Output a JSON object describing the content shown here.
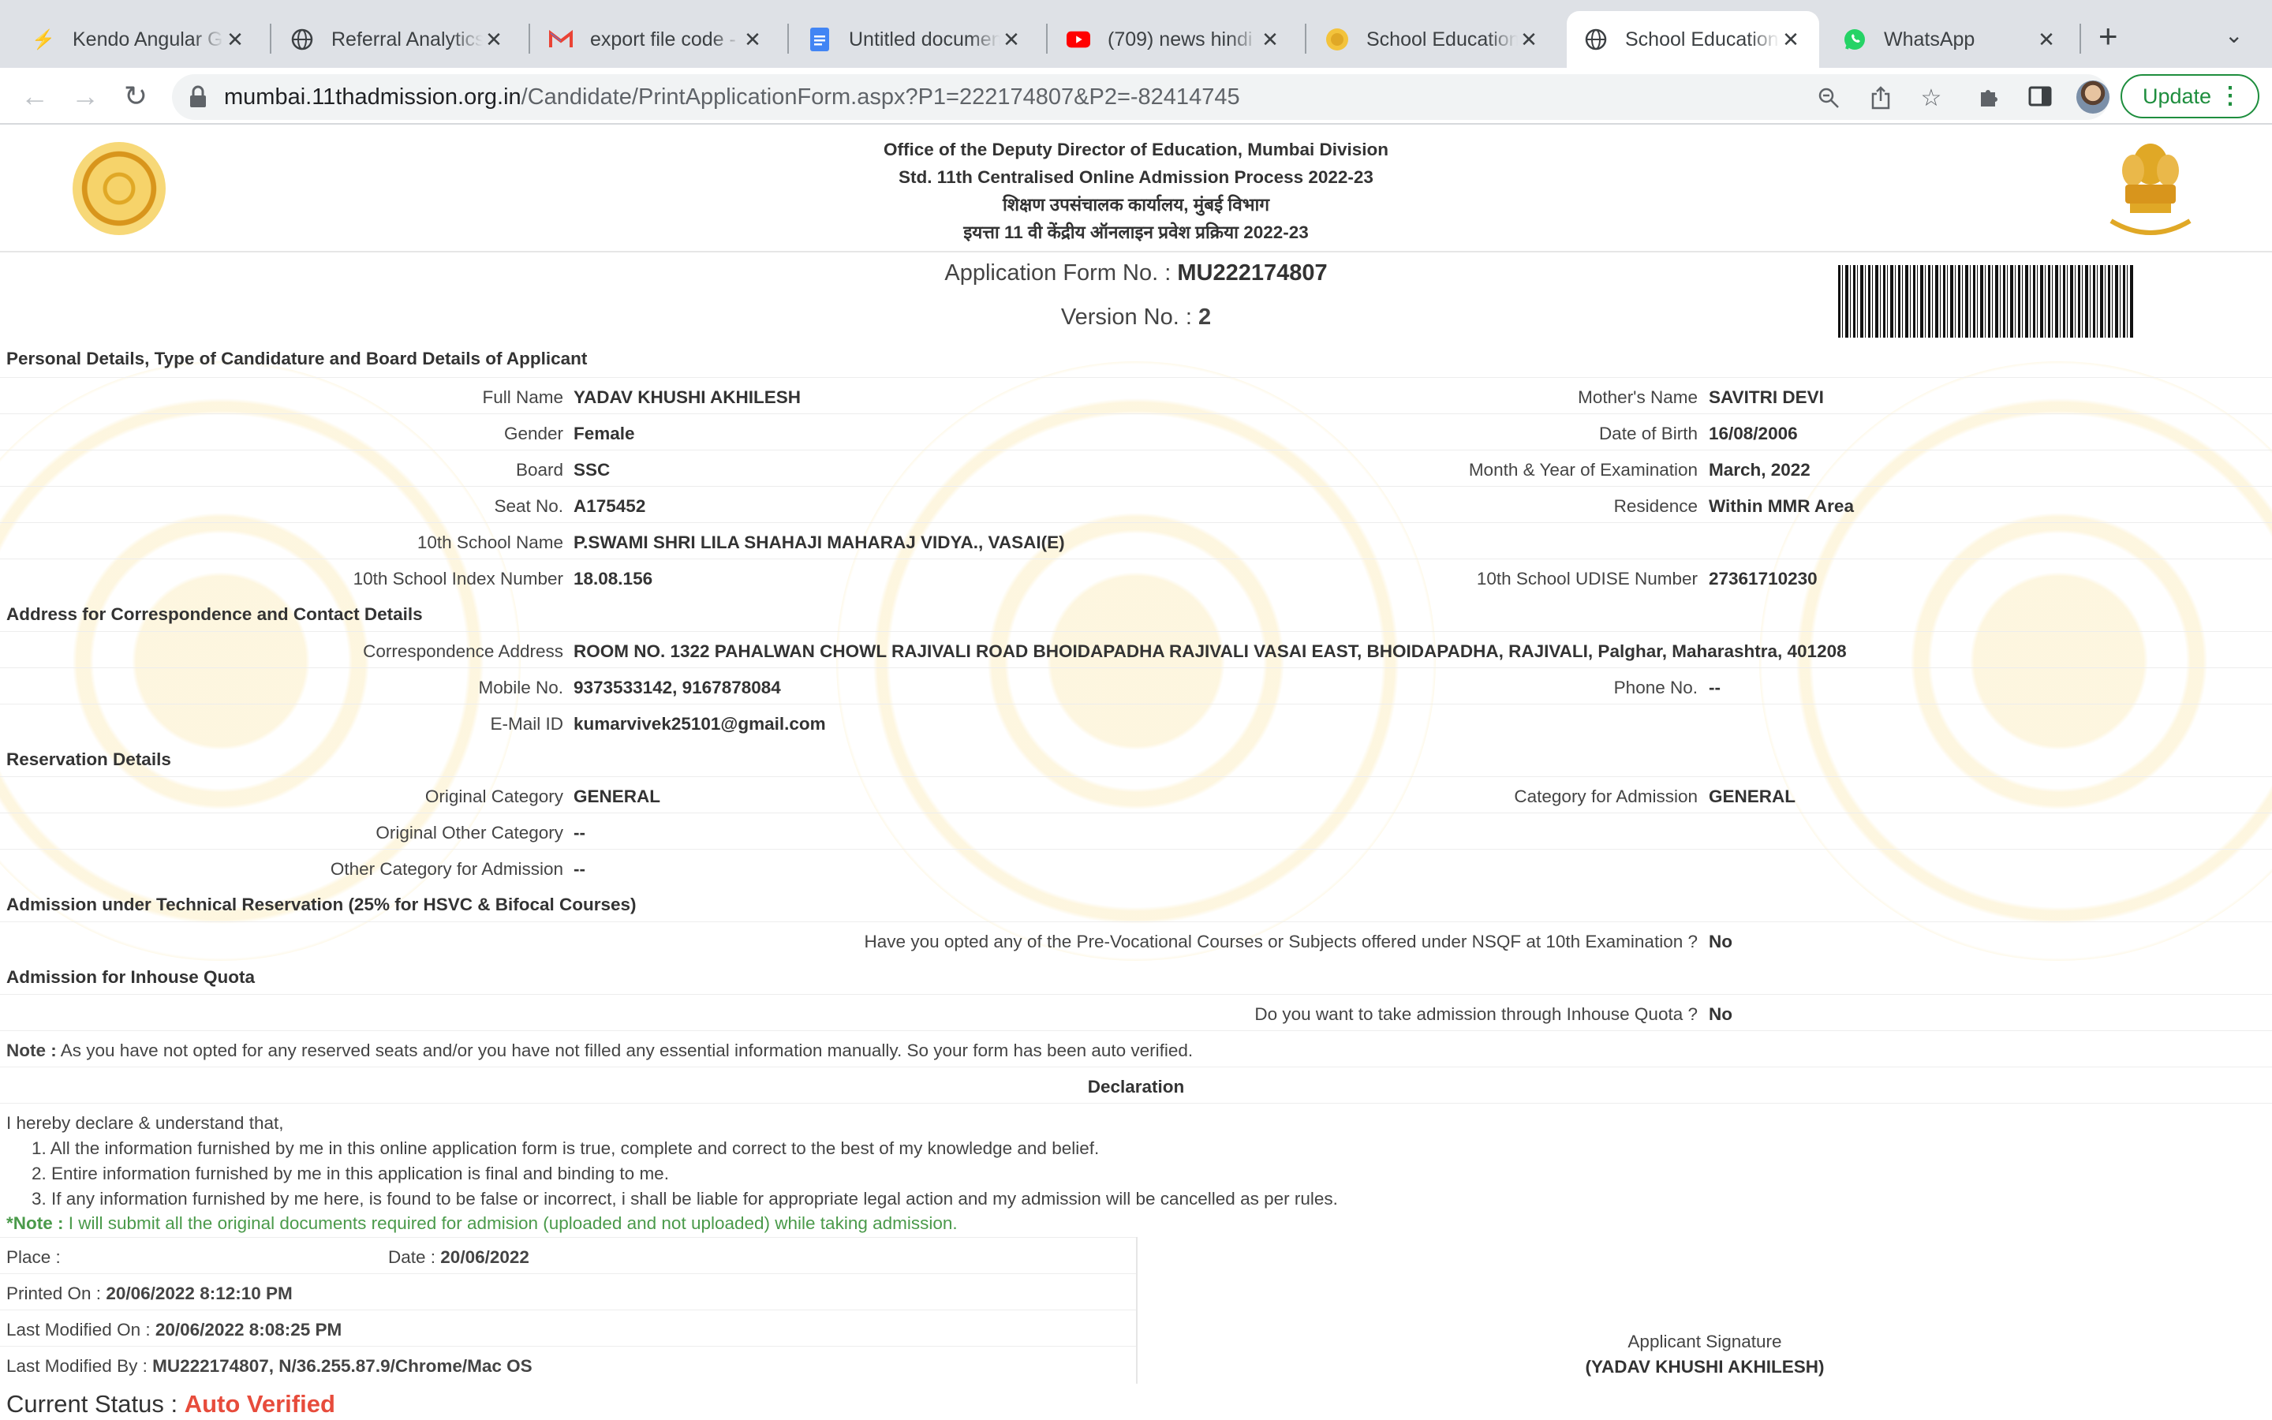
{
  "browser": {
    "tabs": [
      {
        "title": "Kendo Angular Gr",
        "favicon": "bolt-icon",
        "color": "#4b6bfb"
      },
      {
        "title": "Referral Analytics",
        "favicon": "globe-icon",
        "color": "#5f6368"
      },
      {
        "title": "export file code -",
        "favicon": "gmail-icon",
        "color": "#ea4335"
      },
      {
        "title": "Untitled documen",
        "favicon": "docs-icon",
        "color": "#4285f4"
      },
      {
        "title": "(709) news hindi",
        "favicon": "youtube-icon",
        "color": "#ff0000"
      },
      {
        "title": "School Education",
        "favicon": "seal-icon",
        "color": "#e0a826"
      },
      {
        "title": "School Education",
        "favicon": "globe-icon",
        "color": "#5f6368"
      },
      {
        "title": "WhatsApp",
        "favicon": "whatsapp-icon",
        "color": "#25d366"
      }
    ],
    "new_tab": "+",
    "url_host": "mumbai.11thadmission.org.in",
    "url_path": "/Candidate/PrintApplicationForm.aspx?P1=222174807&P2=-82414745",
    "update_label": "Update"
  },
  "header": {
    "line1": "Office of the Deputy Director of Education, Mumbai Division",
    "line2": "Std. 11th Centralised Online Admission Process 2022-23",
    "line3": "शिक्षण उपसंचालक कार्यालय, मुंबई विभाग",
    "line4": "इयत्ता 11 वी केंद्रीय ऑनलाइन प्रवेश प्रक्रिया 2022-23"
  },
  "form": {
    "form_no_label": "Application Form No. :",
    "form_no": "MU222174807",
    "version_label": "Version No. :",
    "version": "2"
  },
  "sections": {
    "personal": "Personal Details, Type of Candidature and Board Details of Applicant",
    "address": "Address for Correspondence and Contact Details",
    "reservation": "Reservation Details",
    "technical": "Admission under Technical Reservation (25% for HSVC & Bifocal Courses)",
    "inhouse": "Admission for Inhouse Quota",
    "declaration": "Declaration"
  },
  "personal": {
    "full_name_label": "Full Name",
    "full_name": "YADAV KHUSHI AKHILESH",
    "mother_label": "Mother's Name",
    "mother": "SAVITRI DEVI",
    "gender_label": "Gender",
    "gender": "Female",
    "dob_label": "Date of Birth",
    "dob": "16/08/2006",
    "board_label": "Board",
    "board": "SSC",
    "exam_label": "Month & Year of Examination",
    "exam": "March, 2022",
    "seat_label": "Seat No.",
    "seat": "A175452",
    "residence_label": "Residence",
    "residence": "Within MMR Area",
    "school_label": "10th School Name",
    "school": "P.SWAMI SHRI LILA SHAHAJI MAHARAJ VIDYA., VASAI(E)",
    "index_label": "10th School Index Number",
    "index": "18.08.156",
    "udise_label": "10th School UDISE Number",
    "udise": "27361710230"
  },
  "address": {
    "corr_label": "Correspondence Address",
    "corr": "ROOM NO. 1322 PAHALWAN CHOWL RAJIVALI ROAD BHOIDAPADHA RAJIVALI VASAI EAST, BHOIDAPADHA, RAJIVALI, Palghar, Maharashtra, 401208",
    "mobile_label": "Mobile No.",
    "mobile": "9373533142, 9167878084",
    "phone_label": "Phone No.",
    "phone": "--",
    "email_label": "E-Mail ID",
    "email": "kumarvivek25101@gmail.com"
  },
  "reservation": {
    "orig_cat_label": "Original Category",
    "orig_cat": "GENERAL",
    "adm_cat_label": "Category for Admission",
    "adm_cat": "GENERAL",
    "orig_other_label": "Original Other Category",
    "orig_other": "--",
    "other_adm_label": "Other Category for Admission",
    "other_adm": "--"
  },
  "technical": {
    "question": "Have you opted any of the Pre-Vocational Courses or Subjects offered under NSQF at 10th Examination ?",
    "answer": "No"
  },
  "inhouse": {
    "question": "Do you want to take admission through Inhouse Quota ?",
    "answer": "No"
  },
  "note": {
    "label": "Note :",
    "text": "As you have not opted for any reserved seats and/or you have not filled any essential information manually. So your form has been auto verified."
  },
  "declaration": {
    "intro": "I hereby declare & understand that,",
    "items": [
      "1. All the information furnished by me in this online application form is true, complete and correct to the best of my knowledge and belief.",
      "2. Entire information furnished by me in this application is final and binding to me.",
      "3. If any information furnished by me here, is found to be false or incorrect, i shall be liable for appropriate legal action and my admission will be cancelled as per rules."
    ],
    "note_label": "*Note :",
    "note_text": "I will submit all the original documents required for admision (uploaded and not uploaded) while taking admission."
  },
  "footer": {
    "place_label": "Place :",
    "date_label": "Date :",
    "date": "20/06/2022",
    "printed_label": "Printed On :",
    "printed": "20/06/2022 8:12:10 PM",
    "modified_label": "Last Modified On :",
    "modified": "20/06/2022 8:08:25 PM",
    "modified_by_label": "Last Modified By :",
    "modified_by": "MU222174807, N/36.255.87.9/Chrome/Mac OS",
    "signature_label": "Applicant Signature",
    "signature_name": "(YADAV KHUSHI AKHILESH)",
    "status_label": "Current Status :",
    "status": "Auto Verified"
  }
}
